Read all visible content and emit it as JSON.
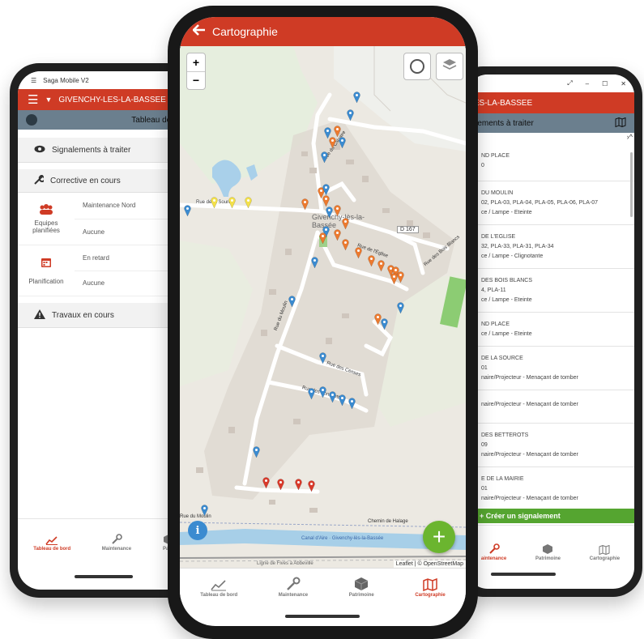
{
  "left_phone": {
    "window_title": "Saga Mobile V2",
    "commune": "GIVENCHY-LES-LA-BASSEE",
    "subheader_title": "Tableau de bord",
    "sections": {
      "signalements": "Signalements à traiter",
      "corrective": "Corrective en cours",
      "travaux": "Travaux en cours"
    },
    "equipes": {
      "label": "Equipes planifiées",
      "value1": "Maintenance Nord",
      "value2": "Aucune"
    },
    "planification": {
      "label": "Planification",
      "value1": "En retard",
      "value2": "Aucune"
    },
    "nav": [
      "Tableau de bord",
      "Maintenance",
      "Patri"
    ]
  },
  "center_phone": {
    "header_title": "Cartographie",
    "zoom_in": "+",
    "zoom_out": "−",
    "fab": "+",
    "info": "i",
    "attribution": "Leaflet | © OpenStreetMap",
    "map_labels": {
      "rue_source": "Rue de la Source",
      "town": "Givenchy-lès-la-Bassée",
      "d167": "D 167",
      "rue_calvaire": "Rue du Calvaire",
      "rue_eglise": "Rue de l'Église",
      "rue_bois_blancs": "Rue des Bois Blancs",
      "rue_moulin": "Rue du Moulin",
      "rue_censes": "Rue des Censes",
      "rue_fontinettes": "Rue des Fontinettes",
      "chemin_halage": "Chemin de Halage",
      "canal": "Canal d'Aire · Givenchy-lès-la-Bassée",
      "rue_moulin_bottom": "Rue du Moulin",
      "ligne": "Ligne de Fives à Abbeville"
    },
    "nav": [
      "Tableau de bord",
      "Maintenance",
      "Patrimoine",
      "Cartographie"
    ],
    "colors": {
      "accent": "#cf3b25",
      "fab": "#6bb52f",
      "pin_blue": "#3b8bd0",
      "pin_orange": "#ec7a2f",
      "pin_red": "#d93a2b",
      "pin_yellow": "#f3e04a"
    }
  },
  "right_phone": {
    "commune": "-LES-LA-BASSEE",
    "subheader_title": "nalements à traiter",
    "items": [
      {
        "line1": "ND PLACE",
        "line2": "0",
        "line3": ""
      },
      {
        "line1": "DU MOULIN",
        "line2": "02, PLA-03, PLA-04, PLA-05, PLA-06, PLA-07",
        "line3": "ce / Lampe - Eteinte"
      },
      {
        "line1": "DE L'EGLISE",
        "line2": "32, PLA-33, PLA-31, PLA-34",
        "line3": "ce / Lampe - Clignotante"
      },
      {
        "line1": "DES BOIS BLANCS",
        "line2": "4, PLA-11",
        "line3": "ce / Lampe - Eteinte"
      },
      {
        "line1": "ND PLACE",
        "line2": "",
        "line3": "ce / Lampe - Eteinte"
      },
      {
        "line1": "DE LA SOURCE",
        "line2": "01",
        "line3": "naire/Projecteur - Menaçant de tomber"
      },
      {
        "line1": "",
        "line2": "",
        "line3": "naire/Projecteur - Menaçant de tomber"
      },
      {
        "line1": "DES BETTEROTS",
        "line2": "09",
        "line3": "naire/Projecteur - Menaçant de tomber"
      },
      {
        "line1": "E DE LA MAIRIE",
        "line2": "01",
        "line3": "naire/Projecteur - Menaçant de tomber"
      }
    ],
    "create_button": "+ Créer un signalement",
    "nav": [
      "aintenance",
      "Patrimoine",
      "Cartographie"
    ]
  }
}
